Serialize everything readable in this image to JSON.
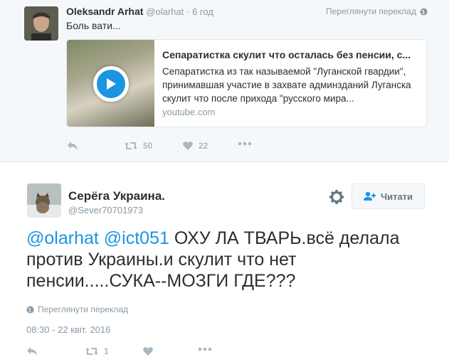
{
  "quoted_tweet": {
    "author_name": "Oleksandr Arhat",
    "author_handle": "@olarhat",
    "time": "· 6 год",
    "translate_label": "Переглянути переклад",
    "text": "Боль вати...",
    "card": {
      "title": "Сепаратистка скулит что осталась без пенсии, с...",
      "description": "Сепаратистка из так называемой \"Луганской гвардии\", принимавшая участие в захвате админзданий Луганска скулит что после прихода \"русского мира...",
      "domain": "youtube.com"
    },
    "retweet_count": "50",
    "like_count": "22"
  },
  "main_tweet": {
    "author_name": "Серёга Украина.",
    "author_handle": "@Sever70701973",
    "follow_label": "Читати",
    "mention1": "@olarhat",
    "mention2": "@ict051",
    "text": " ОХУ  ЛА ТВАРЬ.всё делала против Украины.и скулит что нет пенсии.....СУКА--МОЗГИ ГДЕ???",
    "translate_label": "Переглянути переклад",
    "date": "08:30 - 22 квіт. 2016",
    "retweet_count": "1"
  },
  "colors": {
    "link": "#1b95e0",
    "muted": "#8899a6",
    "icon": "#aab8c2"
  }
}
